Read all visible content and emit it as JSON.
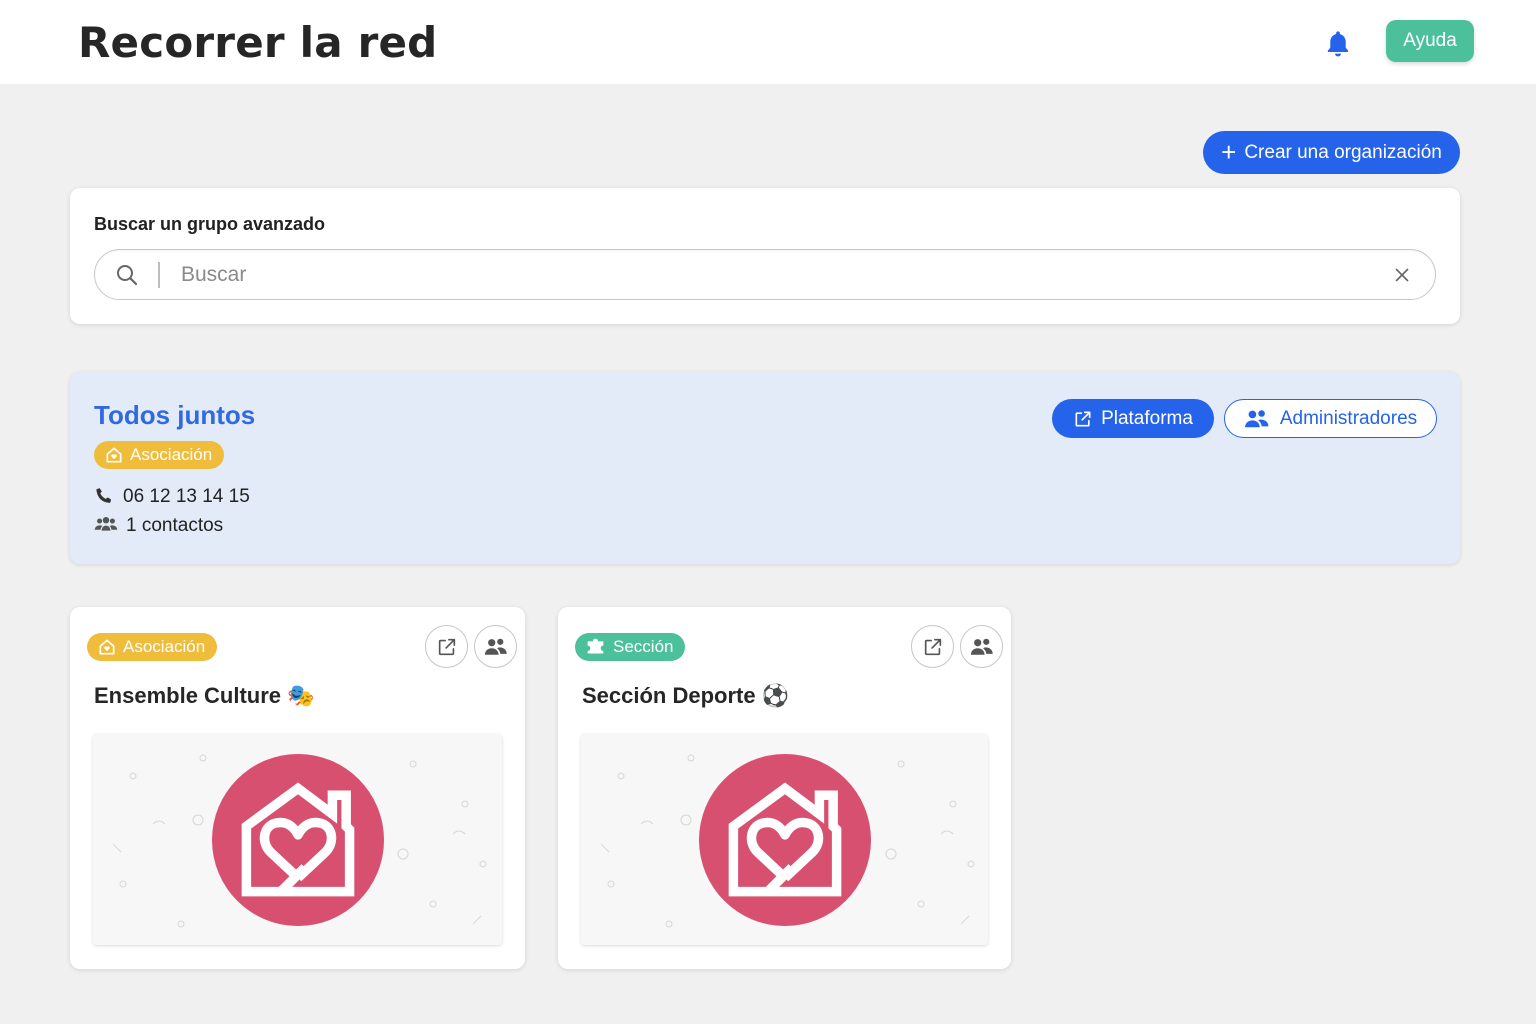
{
  "header": {
    "title": "Recorrer la red",
    "help_label": "Ayuda"
  },
  "actions": {
    "create_label": "Crear una organización"
  },
  "search": {
    "label": "Buscar un grupo avanzado",
    "placeholder": "Buscar",
    "value": ""
  },
  "organization": {
    "name": "Todos juntos",
    "badge": "Asociación",
    "phone": "06 12 13 14 15",
    "contacts": "1 contactos",
    "platform_label": "Plataforma",
    "admins_label": "Administradores"
  },
  "groups": [
    {
      "badge": "Asociación",
      "badge_type": "association",
      "title": "Ensemble Culture 🎭",
      "logo_icon": "house-heart-icon"
    },
    {
      "badge": "Sección",
      "badge_type": "section",
      "title": "Sección Deporte ⚽",
      "logo_icon": "house-heart-icon"
    }
  ],
  "colors": {
    "primary": "#2563eb",
    "association": "#f0bc3c",
    "section": "#4cbf9b",
    "help": "#4cbf9b",
    "logo": "#d8506f",
    "org_background": "#e3ebf9"
  }
}
